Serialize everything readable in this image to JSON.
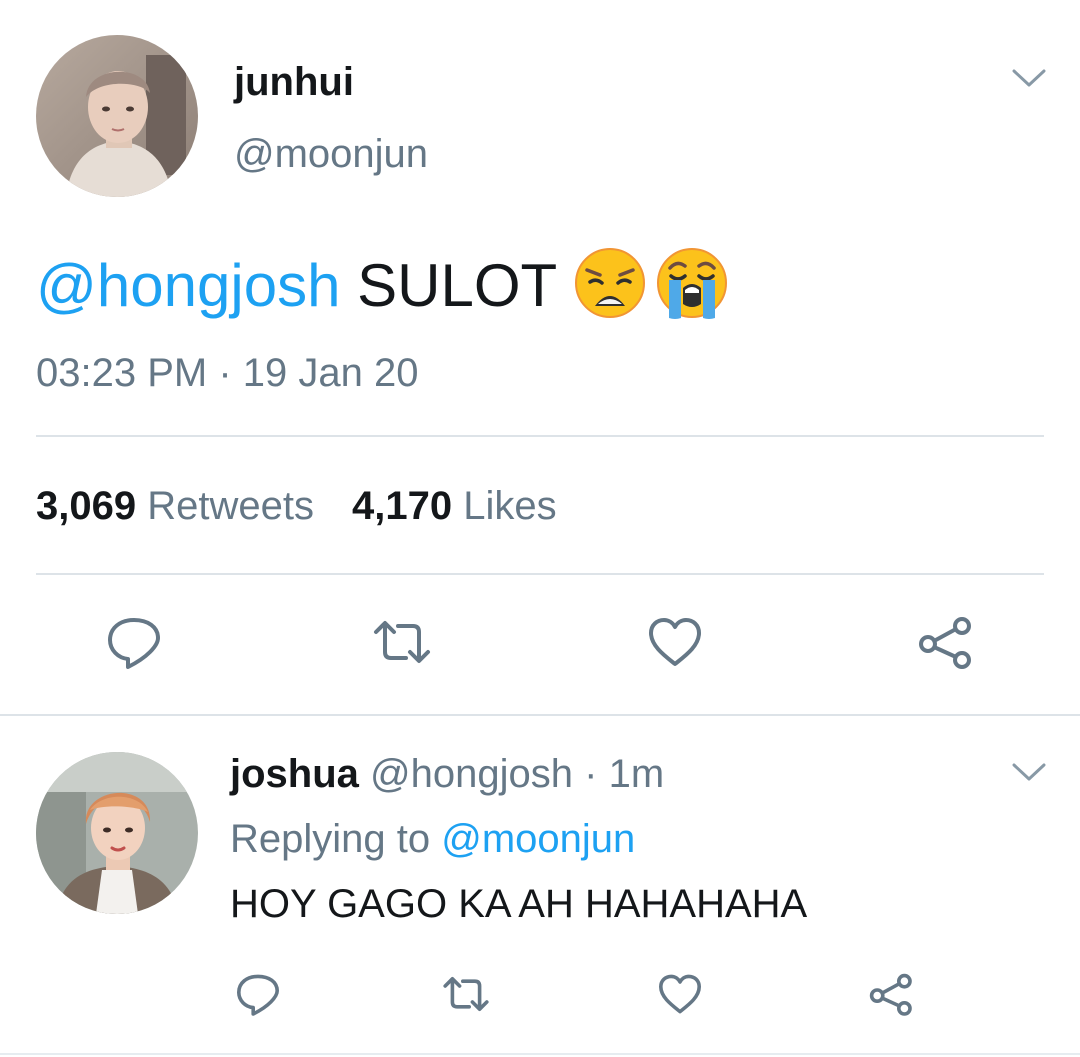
{
  "colors": {
    "accent": "#1da1f2",
    "muted": "#657786",
    "text": "#14171a",
    "divider": "#dde3e8"
  },
  "main_tweet": {
    "author_name": "junhui",
    "author_handle": "@moonjun",
    "mention": "@hongjosh",
    "text": " SULOT ",
    "emojis": [
      "weary-face-emoji",
      "loudly-crying-face-emoji"
    ],
    "timestamp": "03:23 PM · 19 Jan 20",
    "retweets_count": "3,069",
    "retweets_label": "Retweets",
    "likes_count": "4,170",
    "likes_label": "Likes",
    "actions": [
      "reply-icon",
      "retweet-icon",
      "like-icon",
      "share-icon"
    ]
  },
  "reply_tweet": {
    "author_name": "joshua",
    "author_handle": "@hongjosh",
    "time_separator": "·",
    "time_ago": "1m",
    "replying_label": "Replying to",
    "replying_to": "@moonjun",
    "text": "HOY GAGO KA AH HAHAHAHA",
    "actions": [
      "reply-icon",
      "retweet-icon",
      "like-icon",
      "share-icon"
    ]
  }
}
